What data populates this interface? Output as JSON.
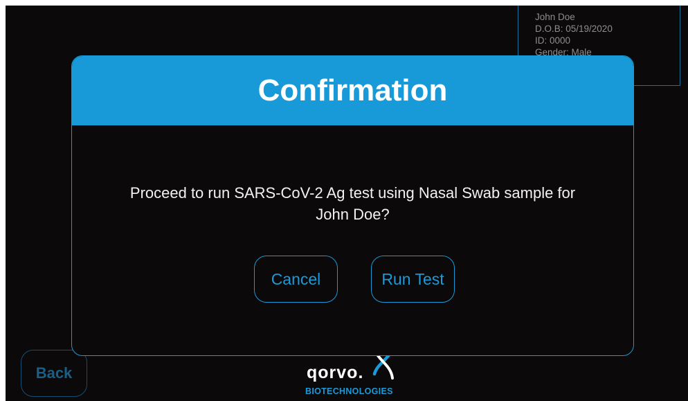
{
  "patient": {
    "name": "John Doe",
    "dob": "D.O.B: 05/19/2020",
    "id": "ID: 0000",
    "gender": "Gender: Male"
  },
  "nav": {
    "back_label": "Back"
  },
  "dialog": {
    "title": "Confirmation",
    "message_line1": "Proceed to run SARS-CoV-2 Ag test using Nasal Swab sample for",
    "message_line2": "John Doe?",
    "cancel_label": "Cancel",
    "run_label": "Run Test"
  },
  "logo": {
    "wordmark": "qorvo.",
    "subtitle": "BIOTECHNOLOGIES"
  },
  "colors": {
    "accent": "#199ad8",
    "background": "#0b0909",
    "text": "#f2f2f2"
  }
}
